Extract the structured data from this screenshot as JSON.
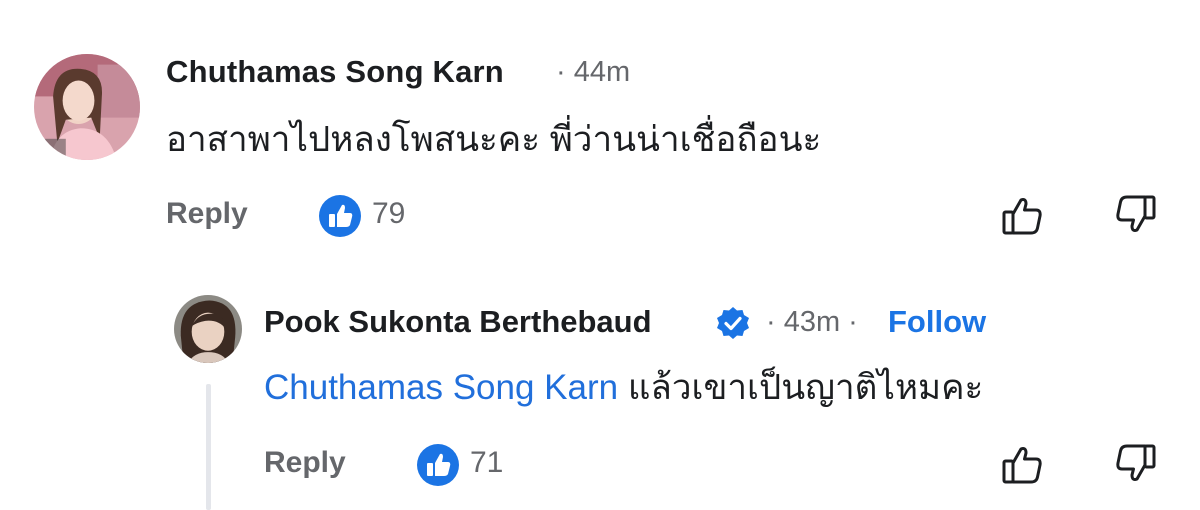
{
  "comments": [
    {
      "author": "Chuthamas Song Karn",
      "meta": "· 44m",
      "text": "อาสาพาไปหลงโพสนะคะ พี่ว่านน่าเชื่อถือนะ",
      "reply_label": "Reply",
      "like_count": "79"
    },
    {
      "author": "Pook Sukonta Berthebaud",
      "verified": true,
      "meta": "· 43m ·",
      "follow_label": "Follow",
      "mention": "Chuthamas Song Karn",
      "text": "แล้วเขาเป็นญาติไหมคะ",
      "reply_label": "Reply",
      "like_count": "71"
    }
  ],
  "colors": {
    "like_blue": "#1b74e4",
    "mention_blue": "#216fdb",
    "meta_gray": "#65676b",
    "thread_line": "#e4e6eb"
  },
  "icons": {
    "reaction": "like-reaction-icon",
    "thumb_up": "thumbs-up-outline-icon",
    "thumb_down": "thumbs-down-outline-icon",
    "verified": "verified-badge-icon"
  }
}
